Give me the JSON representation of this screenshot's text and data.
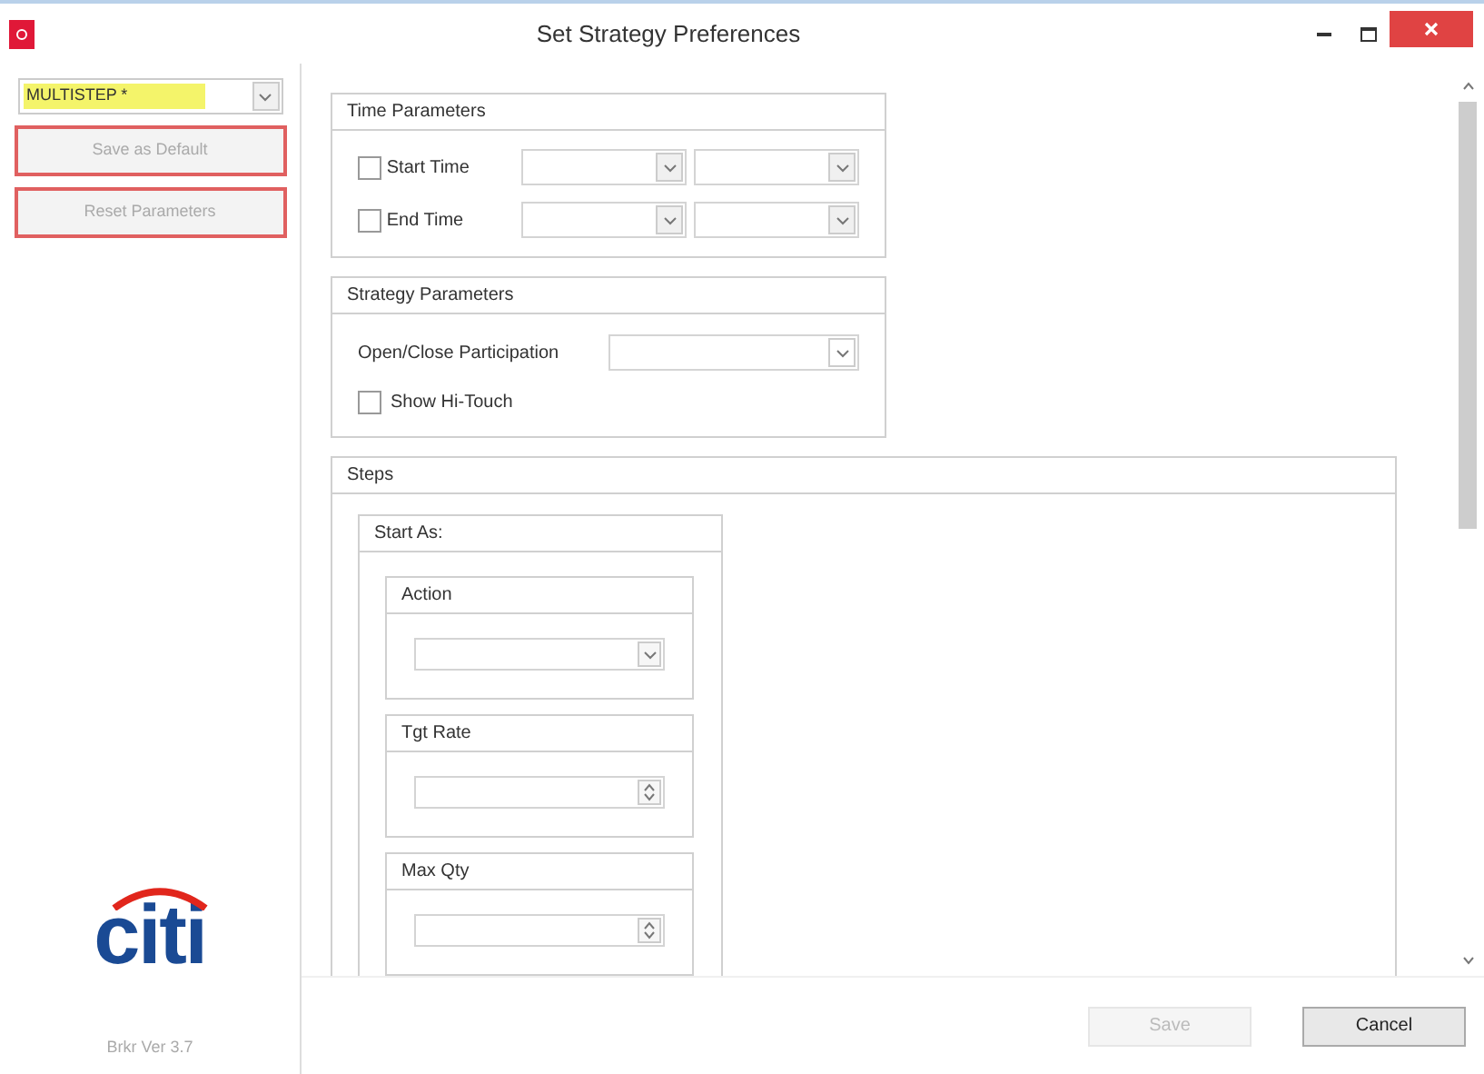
{
  "window": {
    "title": "Set Strategy Preferences"
  },
  "sidebar": {
    "strategy": {
      "value": "MULTISTEP *",
      "highlighted": true
    },
    "buttons": [
      {
        "label": "Save as Default",
        "disabled": true
      },
      {
        "label": "Reset Parameters",
        "disabled": true
      }
    ],
    "logo": "citi",
    "version": "Brkr Ver 3.7"
  },
  "time_parameters": {
    "title": "Time Parameters",
    "rows": [
      {
        "label": "Start Time",
        "checked": false
      },
      {
        "label": "End Time",
        "checked": false
      }
    ]
  },
  "strategy_parameters": {
    "title": "Strategy Parameters",
    "participation_label": "Open/Close Participation",
    "hi_touch": {
      "label": "Show Hi-Touch",
      "checked": false
    }
  },
  "steps": {
    "title": "Steps",
    "start_as": {
      "title": "Start As:",
      "fields": [
        {
          "label": "Action",
          "kind": "dropdown"
        },
        {
          "label": "Tgt Rate",
          "kind": "spinner"
        },
        {
          "label": "Max Qty",
          "kind": "spinner"
        }
      ]
    }
  },
  "footer": {
    "buttons": [
      {
        "label": "Save",
        "disabled": true
      },
      {
        "label": "Cancel",
        "disabled": false
      }
    ]
  }
}
